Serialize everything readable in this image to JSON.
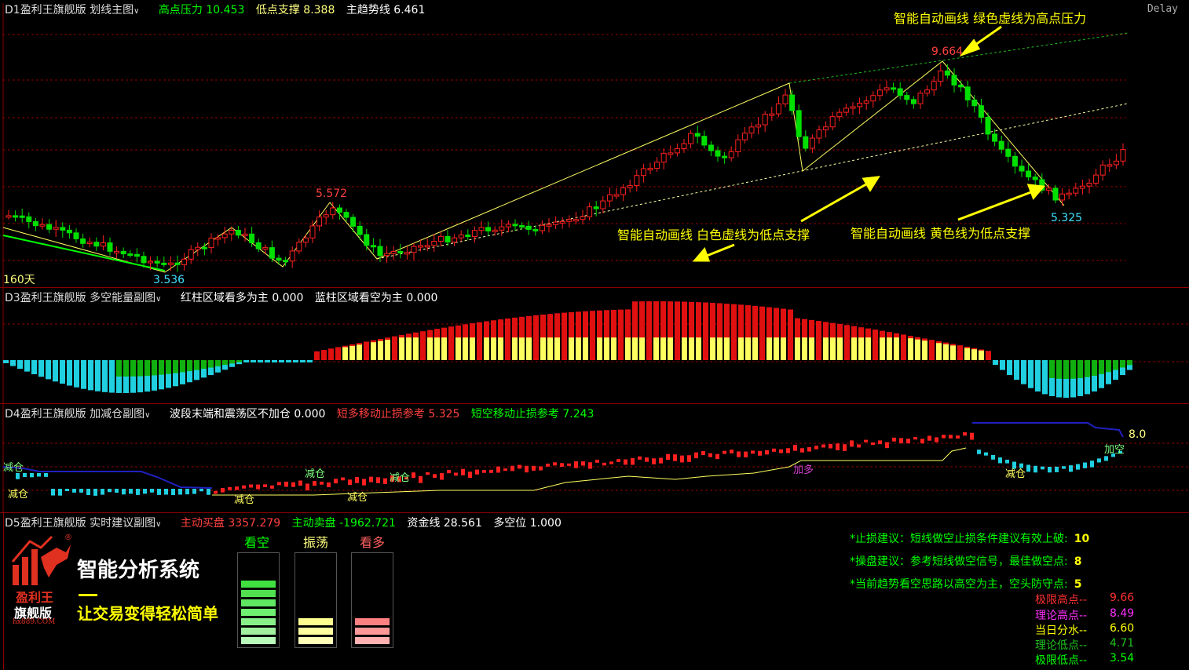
{
  "delay_label": "Delay",
  "pane1": {
    "title": "D1盈利王旗舰版 划线主图",
    "high_label": "高点压力",
    "high_value": "10.453",
    "low_label": "低点支撑",
    "low_value": "8.388",
    "trend_label": "主趋势线",
    "trend_value": "6.461",
    "days_label": "160天",
    "price_labels": {
      "p1": "5.572",
      "p2": "3.536",
      "p3": "9.664",
      "p4": "5.325"
    },
    "annotations": {
      "a1": "智能自动画线  绿色虚线为高点压力",
      "a2": "智能自动画线  白色虚线为低点支撑",
      "a3": "智能自动画线  黄色线为低点支撑"
    }
  },
  "pane2": {
    "title": "D3盈利王旗舰版 多空能量副图",
    "red_label": "红柱区域看多为主",
    "red_value": "0.000",
    "blue_label": "蓝柱区域看空为主",
    "blue_value": "0.000"
  },
  "pane3": {
    "title": "D4盈利王旗舰版 加减仓副图",
    "note_label": "波段末端和震荡区不加仓",
    "note_value": "0.000",
    "long_stop_label": "短多移动止损参考",
    "long_stop_value": "5.325",
    "short_stop_label": "短空移动止损参考",
    "short_stop_value": "7.243",
    "right_value": "8.0",
    "tags": {
      "reduce": "减仓",
      "add_long": "加多",
      "add_short": "加空",
      "reduce2": "减仓"
    }
  },
  "pane4": {
    "title": "D5盈利王旗舰版 实时建议副图",
    "buy_label": "主动买盘",
    "buy_value": "3357.279",
    "sell_label": "主动卖盘",
    "sell_value": "-1962.721",
    "fund_label": "资金线",
    "fund_value": "28.561",
    "pos_label": "多空位",
    "pos_value": "1.000",
    "logo": {
      "brand1": "盈利王",
      "brand2": "旗舰版",
      "site": "hx889.COM",
      "reg": "®"
    },
    "slogan1": "智能分析系统",
    "slogan2": "让交易变得轻松简单",
    "towers": {
      "bear": "看空",
      "range": "振荡",
      "bull": "看多"
    },
    "advice": [
      {
        "text": "*止损建议：短线做空止损条件建议有效上破:",
        "value": "10"
      },
      {
        "text": "*操盘建议：参考短线做空信号，最佳做空点:",
        "value": "8"
      },
      {
        "text": "*当前趋势看空思路以高空为主，空头防守点:",
        "value": "5"
      }
    ],
    "levels": [
      {
        "label": "极限高点--",
        "value": "9.66",
        "color": "#ff3030"
      },
      {
        "label": "理论高点--",
        "value": "8.49",
        "color": "#ff30ff"
      },
      {
        "label": "当日分水--",
        "value": "6.60",
        "color": "#ffff00"
      },
      {
        "label": "理论低点--",
        "value": "4.71",
        "color": "#20c020"
      },
      {
        "label": "极限低点--",
        "value": "3.54",
        "color": "#00ff00"
      }
    ]
  }
}
